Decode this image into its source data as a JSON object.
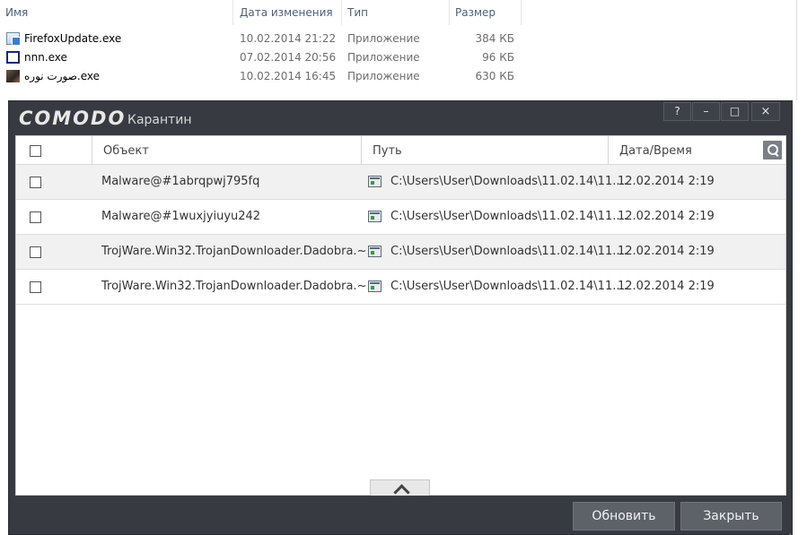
{
  "explorer": {
    "columns": {
      "name": "Имя",
      "date": "Дата изменения",
      "type": "Тип",
      "size": "Размер"
    },
    "sort_indicator": "^",
    "files": [
      {
        "name": "FirefoxUpdate.exe",
        "date": "10.02.2014 21:22",
        "type": "Приложение",
        "size": "384 КБ",
        "icon": "exe-window-icon"
      },
      {
        "name": "nnn.exe",
        "date": "07.02.2014 20:56",
        "type": "Приложение",
        "size": "96 КБ",
        "icon": "blank-window-icon"
      },
      {
        "name": "صورت نوره.exe",
        "date": "10.02.2014 16:45",
        "type": "Приложение",
        "size": "630 КБ",
        "icon": "image-thumbnail-icon"
      }
    ]
  },
  "quarantine": {
    "logo": "COMODO",
    "title": "Карантин",
    "controls": {
      "help": "?",
      "minimize": "–",
      "maximize": "□",
      "close": "×"
    },
    "columns": {
      "object": "Объект",
      "path": "Путь",
      "datetime": "Дата/Время"
    },
    "items": [
      {
        "object": "Malware@#1abrqpwj795fq",
        "path": "C:\\Users\\User\\Downloads\\11.02.14\\11....",
        "datetime": "12.02.2014 2:19"
      },
      {
        "object": "Malware@#1wuxjyiuyu242",
        "path": "C:\\Users\\User\\Downloads\\11.02.14\\11....",
        "datetime": "12.02.2014 2:19"
      },
      {
        "object": "TrojWare.Win32.TrojanDownloader.Dadobra.~...",
        "path": "C:\\Users\\User\\Downloads\\11.02.14\\11....",
        "datetime": "12.02.2014 2:19"
      },
      {
        "object": "TrojWare.Win32.TrojanDownloader.Dadobra.~...",
        "path": "C:\\Users\\User\\Downloads\\11.02.14\\11....",
        "datetime": "12.02.2014 2:19"
      }
    ],
    "buttons": {
      "refresh": "Обновить",
      "close": "Закрыть"
    }
  },
  "colors": {
    "window_bg": "#373b41",
    "button_bg": "#5d6168",
    "row_alt": "#f1f1f1"
  }
}
